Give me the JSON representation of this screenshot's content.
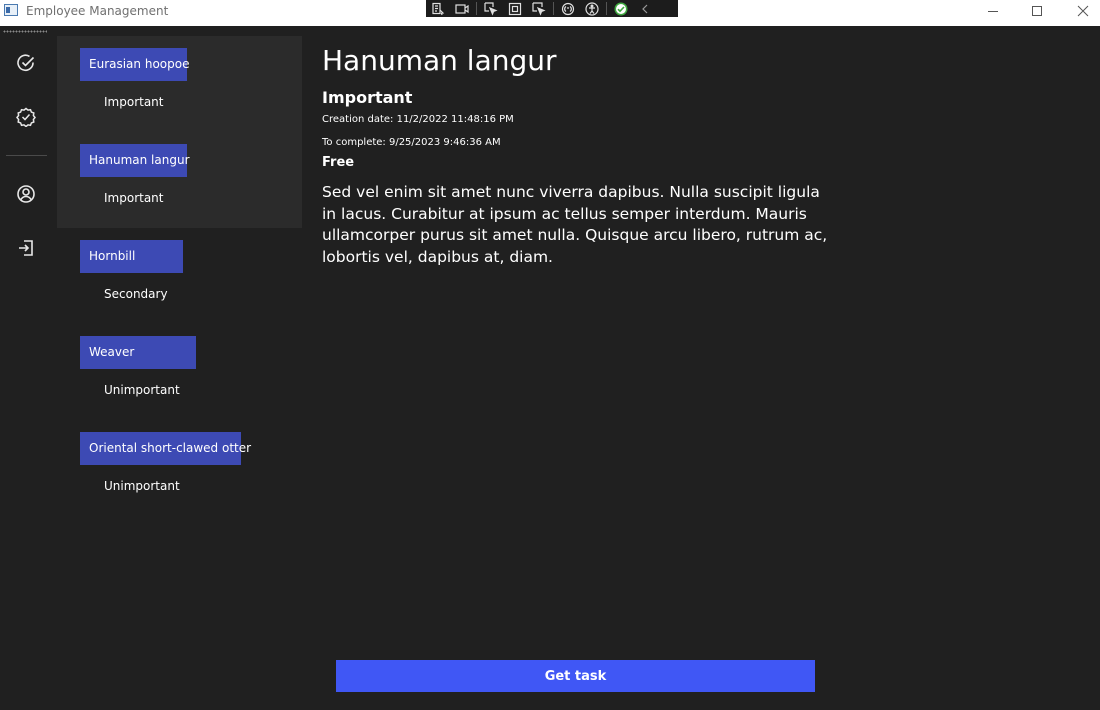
{
  "window": {
    "title": "Employee Management",
    "minimize_icon": "minimize-icon",
    "maximize_icon": "maximize-icon",
    "close_icon": "close-icon"
  },
  "dev_toolbar": {
    "icons": [
      "live-visual-tree-icon",
      "record-icon",
      "select-element-icon",
      "display-adorners-icon",
      "track-focus-icon",
      "binding-failures-icon",
      "accessibility-checker-icon",
      "hot-reload-ok-icon",
      "collapse-chevron-icon"
    ]
  },
  "nav": {
    "items": [
      {
        "name": "tasks",
        "icon": "check-circle-icon"
      },
      {
        "name": "completed",
        "icon": "badge-check-icon"
      },
      {
        "name": "profile",
        "icon": "user-circle-icon"
      },
      {
        "name": "logout",
        "icon": "sign-out-icon"
      }
    ]
  },
  "tasks": [
    {
      "name": "Eurasian hoopoe",
      "priority": "Important"
    },
    {
      "name": "Hanuman langur",
      "priority": "Important"
    },
    {
      "name": "Hornbill",
      "priority": "Secondary"
    },
    {
      "name": "Weaver",
      "priority": "Unimportant"
    },
    {
      "name": "Oriental short-clawed otter",
      "priority": "Unimportant"
    }
  ],
  "detail": {
    "title": "Hanuman langur",
    "priority": "Important",
    "creation_date": "Creation date: 11/2/2022 11:48:16 PM",
    "to_complete": "To complete: 9/25/2023 9:46:36 AM",
    "status": "Free",
    "description": "Sed vel enim sit amet nunc viverra dapibus. Nulla suscipit ligula in lacus. Curabitur at ipsum ac tellus semper interdum. Mauris ullamcorper purus sit amet nulla. Quisque arcu libero, rutrum ac, lobortis vel, dapibus at, diam."
  },
  "actions": {
    "get_task": "Get task"
  },
  "colors": {
    "background": "#202020",
    "list_hover": "#2b2b2b",
    "task_name_bg": "#3d4ab4",
    "accent_button": "#4057f5"
  }
}
